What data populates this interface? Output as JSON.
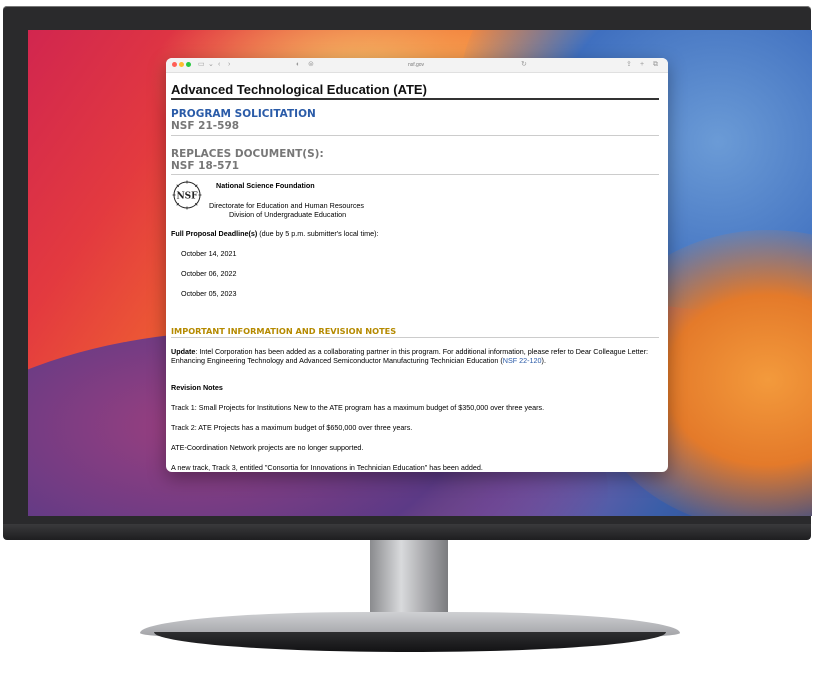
{
  "browser": {
    "url": "nsf.gov"
  },
  "page": {
    "title": "Advanced Technological Education (ATE)",
    "program_solicitation_label": "PROGRAM SOLICITATION",
    "program_solicitation_number": "NSF 21-598",
    "replaces_label": "REPLACES DOCUMENT(S):",
    "replaces_number": "NSF 18-571",
    "org_name": "National Science Foundation",
    "directorate": "Directorate for Education and Human Resources",
    "division": "Division of Undergraduate Education",
    "logo_text": "NSF",
    "deadline_label": "Full Proposal Deadline(s)",
    "deadline_note": " (due by 5 p.m. submitter's local time):",
    "deadlines": [
      "October 14, 2021",
      "October 06, 2022",
      "October 05, 2023"
    ],
    "info_heading": "IMPORTANT INFORMATION AND REVISION NOTES",
    "update_label": "Update",
    "update_text": ": Intel Corporation has been added as a collaborating partner in this program. For additional information, please refer to Dear Colleague Letter: Enhancing Engineering Technology and Advanced Semiconductor Manufacturing Technician Education (",
    "update_link": "NSF 22-120",
    "update_tail": ").",
    "revision_notes_label": "Revision Notes",
    "track1": "Track 1: Small Projects for Institutions New to the ATE program has a maximum budget of $350,000 over three years.",
    "track2": "Track 2: ATE Projects has a maximum budget of $650,000 over three years.",
    "coordination": "ATE-Coordination Network projects are no longer supported.",
    "track3": "A new track, Track 3, entitled \"Consortia for Innovations in Technician Education\" has been added."
  },
  "colors": {
    "heading_blue": "#2a5ba8",
    "heading_grey": "#777777",
    "heading_gold": "#b58a00"
  }
}
